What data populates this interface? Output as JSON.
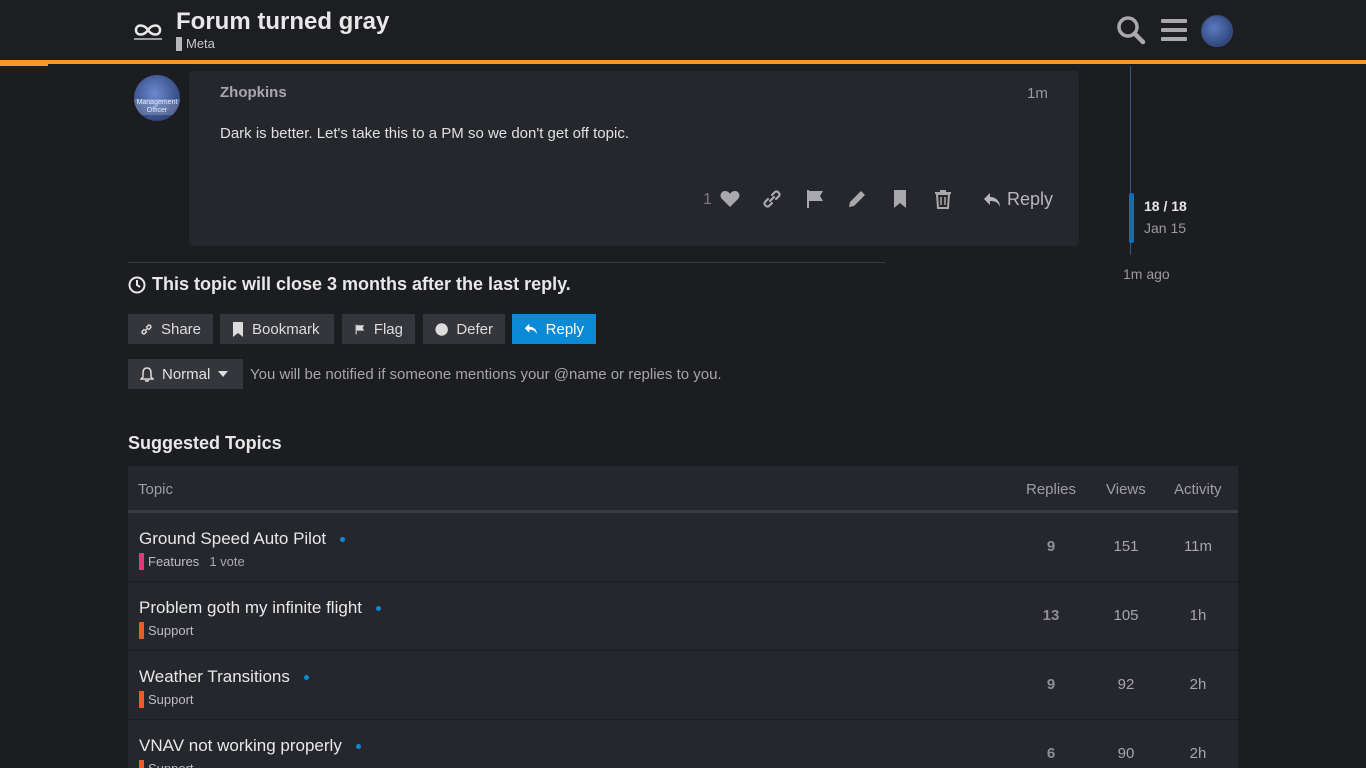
{
  "header": {
    "title": "Forum turned gray",
    "category": "Meta",
    "category_color": "#b6b6b6",
    "accent_color": "#f59a2b"
  },
  "post": {
    "username": "Zhopkins",
    "time": "1m",
    "body": "Dark is better. Let's take this to a PM so we don't get off topic.",
    "like_count": "1",
    "reply_label": "Reply",
    "avatar_text": "Management Officer"
  },
  "timeline": {
    "count": "18 / 18",
    "date": "Jan 15",
    "ago": "1m ago"
  },
  "topic_notice": "This topic will close 3 months after the last reply.",
  "buttons": {
    "share": "Share",
    "bookmark": "Bookmark",
    "flag": "Flag",
    "defer": "Defer",
    "reply": "Reply"
  },
  "notification": {
    "level": "Normal",
    "description": "You will be notified if someone mentions your @name or replies to you."
  },
  "suggested": {
    "title": "Suggested Topics",
    "columns": {
      "topic": "Topic",
      "replies": "Replies",
      "views": "Views",
      "activity": "Activity"
    },
    "rows": [
      {
        "title": "Ground Speed Auto Pilot",
        "category": "Features",
        "category_color": "#e8367a",
        "votes": "1 vote",
        "replies": "9",
        "views": "151",
        "activity": "11m"
      },
      {
        "title": "Problem goth my infinite flight",
        "category": "Support",
        "category_color": "#f05a28",
        "votes": "",
        "replies": "13",
        "views": "105",
        "activity": "1h"
      },
      {
        "title": "Weather Transitions",
        "category": "Support",
        "category_color": "#f05a28",
        "votes": "",
        "replies": "9",
        "views": "92",
        "activity": "2h"
      },
      {
        "title": "VNAV not working properly",
        "category": "Support",
        "category_color": "#f05a28",
        "votes": "",
        "replies": "6",
        "views": "90",
        "activity": "2h"
      }
    ]
  }
}
